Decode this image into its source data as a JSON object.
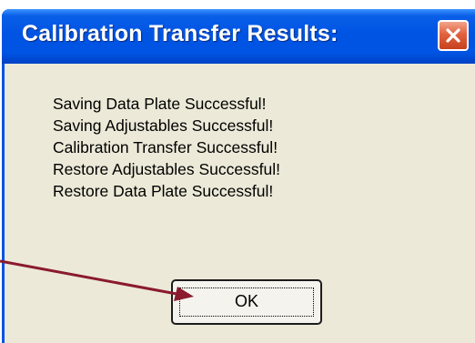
{
  "dialog": {
    "title": "Calibration Transfer Results:",
    "close_icon": "close-icon",
    "messages": [
      "Saving Data Plate Successful!",
      "Saving Adjustables Successful!",
      "Calibration Transfer Successful!",
      "Restore Adjustables Successful!",
      "Restore Data Plate Successful!"
    ],
    "ok_label": "OK"
  },
  "colors": {
    "titlebar": "#0054e3",
    "window_background": "#ece9d8",
    "close_button": "#e2623f",
    "annotation_arrow": "#8b1a2e"
  }
}
